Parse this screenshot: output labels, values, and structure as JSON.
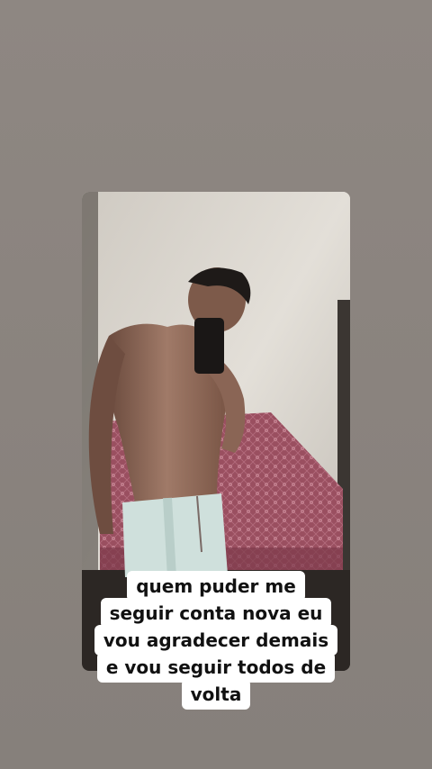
{
  "story": {
    "caption_lines": [
      "quem puder me",
      "seguir conta nova eu",
      "vou agradecer demais",
      "e vou seguir todos de",
      "volta"
    ],
    "caption_background": "#ffffff",
    "caption_text_color": "#111111",
    "background_color": "#8c8580"
  }
}
